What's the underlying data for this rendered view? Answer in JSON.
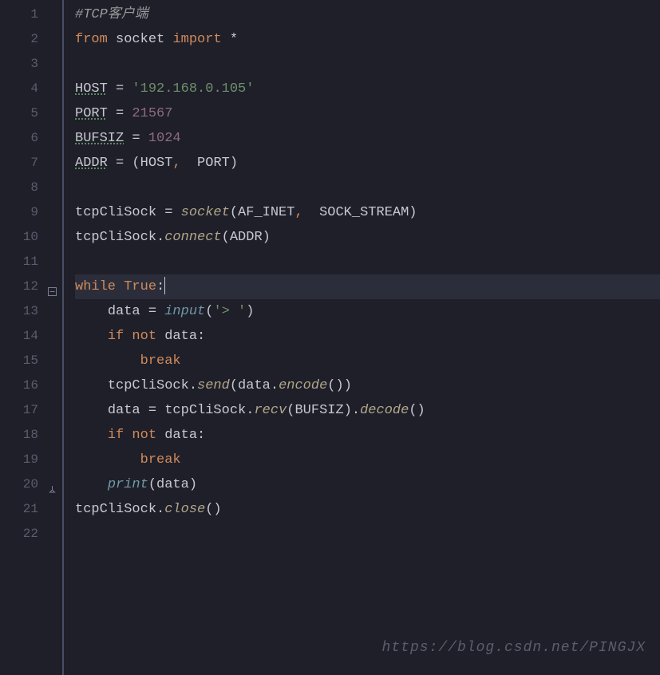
{
  "line_count": 22,
  "active_line": 12,
  "colors": {
    "bg": "#1e1f29",
    "gutter_fg": "#5a5d6e",
    "default": "#c7c9d1",
    "comment": "#9a9a9a",
    "keyword": "#d08a5b",
    "string": "#6f8f6c",
    "number": "#8f6b7c",
    "func": "#b2a68a",
    "builtin": "#6f98a8",
    "constant": "#8d8fa6"
  },
  "fold_markers": {
    "12": "collapse",
    "20": "end"
  },
  "watermark": "https://blog.csdn.net/PINGJX",
  "code": [
    {
      "n": 1,
      "tokens": [
        {
          "t": "#TCP客户端",
          "c": "s-comment"
        }
      ]
    },
    {
      "n": 2,
      "tokens": [
        {
          "t": "from ",
          "c": "s-kw"
        },
        {
          "t": "socket ",
          "c": "s-default"
        },
        {
          "t": "import ",
          "c": "s-kw"
        },
        {
          "t": "*",
          "c": "s-op"
        }
      ]
    },
    {
      "n": 3,
      "tokens": []
    },
    {
      "n": 4,
      "tokens": [
        {
          "t": "HOST",
          "c": "s-default underline"
        },
        {
          "t": " = ",
          "c": "s-op"
        },
        {
          "t": "'192.168.0.105'",
          "c": "s-string"
        }
      ]
    },
    {
      "n": 5,
      "tokens": [
        {
          "t": "PORT",
          "c": "s-default underline"
        },
        {
          "t": " = ",
          "c": "s-op"
        },
        {
          "t": "21567",
          "c": "s-num"
        }
      ]
    },
    {
      "n": 6,
      "tokens": [
        {
          "t": "BUFSIZ",
          "c": "s-default underline"
        },
        {
          "t": " = ",
          "c": "s-op"
        },
        {
          "t": "1024",
          "c": "s-num"
        }
      ]
    },
    {
      "n": 7,
      "tokens": [
        {
          "t": "ADDR",
          "c": "s-default underline"
        },
        {
          "t": " = (",
          "c": "s-op"
        },
        {
          "t": "HOST",
          "c": "s-default"
        },
        {
          "t": ", ",
          "c": "s-kw"
        },
        {
          "t": " PORT",
          "c": "s-default"
        },
        {
          "t": ")",
          "c": "s-op"
        }
      ]
    },
    {
      "n": 8,
      "tokens": []
    },
    {
      "n": 9,
      "tokens": [
        {
          "t": "tcpCliSock = ",
          "c": "s-default"
        },
        {
          "t": "socket",
          "c": "s-call"
        },
        {
          "t": "(",
          "c": "s-op"
        },
        {
          "t": "AF_INET",
          "c": "s-default"
        },
        {
          "t": ", ",
          "c": "s-kw"
        },
        {
          "t": " SOCK_STREAM",
          "c": "s-default"
        },
        {
          "t": ")",
          "c": "s-op"
        }
      ]
    },
    {
      "n": 10,
      "tokens": [
        {
          "t": "tcpCliSock.",
          "c": "s-default"
        },
        {
          "t": "connect",
          "c": "s-call"
        },
        {
          "t": "(",
          "c": "s-op"
        },
        {
          "t": "ADDR",
          "c": "s-default"
        },
        {
          "t": ")",
          "c": "s-op"
        }
      ]
    },
    {
      "n": 11,
      "tokens": []
    },
    {
      "n": 12,
      "tokens": [
        {
          "t": "while ",
          "c": "s-kw"
        },
        {
          "t": "True",
          "c": "s-kw"
        },
        {
          "t": ":",
          "c": "s-op"
        }
      ],
      "cursor": true
    },
    {
      "n": 13,
      "indent": 1,
      "tokens": [
        {
          "t": "    ",
          "c": ""
        },
        {
          "t": "data = ",
          "c": "s-default"
        },
        {
          "t": "input",
          "c": "s-builtin"
        },
        {
          "t": "(",
          "c": "s-op"
        },
        {
          "t": "'> '",
          "c": "s-string"
        },
        {
          "t": ")",
          "c": "s-op"
        }
      ]
    },
    {
      "n": 14,
      "indent": 1,
      "tokens": [
        {
          "t": "    ",
          "c": ""
        },
        {
          "t": "if not ",
          "c": "s-kw"
        },
        {
          "t": "data",
          "c": "s-default"
        },
        {
          "t": ":",
          "c": "s-op"
        }
      ]
    },
    {
      "n": 15,
      "indent": 2,
      "tokens": [
        {
          "t": "        ",
          "c": ""
        },
        {
          "t": "break",
          "c": "s-kw"
        }
      ]
    },
    {
      "n": 16,
      "indent": 1,
      "tokens": [
        {
          "t": "    ",
          "c": ""
        },
        {
          "t": "tcpCliSock.",
          "c": "s-default"
        },
        {
          "t": "send",
          "c": "s-call"
        },
        {
          "t": "(",
          "c": "s-op"
        },
        {
          "t": "data.",
          "c": "s-default"
        },
        {
          "t": "encode",
          "c": "s-call"
        },
        {
          "t": "()",
          "c": "s-op"
        },
        {
          "t": ")",
          "c": "s-op"
        }
      ]
    },
    {
      "n": 17,
      "indent": 1,
      "tokens": [
        {
          "t": "    ",
          "c": ""
        },
        {
          "t": "data = tcpCliSock.",
          "c": "s-default"
        },
        {
          "t": "recv",
          "c": "s-call"
        },
        {
          "t": "(",
          "c": "s-op"
        },
        {
          "t": "BUFSIZ",
          "c": "s-default"
        },
        {
          "t": ").",
          "c": "s-op"
        },
        {
          "t": "decode",
          "c": "s-call"
        },
        {
          "t": "()",
          "c": "s-op"
        }
      ]
    },
    {
      "n": 18,
      "indent": 1,
      "tokens": [
        {
          "t": "    ",
          "c": ""
        },
        {
          "t": "if not ",
          "c": "s-kw"
        },
        {
          "t": "data",
          "c": "s-default"
        },
        {
          "t": ":",
          "c": "s-op"
        }
      ]
    },
    {
      "n": 19,
      "indent": 2,
      "tokens": [
        {
          "t": "        ",
          "c": ""
        },
        {
          "t": "break",
          "c": "s-kw"
        }
      ]
    },
    {
      "n": 20,
      "indent": 1,
      "tokens": [
        {
          "t": "    ",
          "c": ""
        },
        {
          "t": "print",
          "c": "s-builtin"
        },
        {
          "t": "(",
          "c": "s-op"
        },
        {
          "t": "data",
          "c": "s-default"
        },
        {
          "t": ")",
          "c": "s-op"
        }
      ]
    },
    {
      "n": 21,
      "tokens": [
        {
          "t": "tcpCliSock.",
          "c": "s-default"
        },
        {
          "t": "close",
          "c": "s-call"
        },
        {
          "t": "()",
          "c": "s-op"
        }
      ]
    },
    {
      "n": 22,
      "tokens": []
    }
  ]
}
